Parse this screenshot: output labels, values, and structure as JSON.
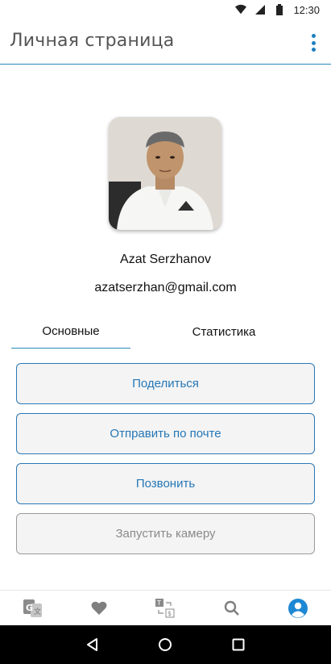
{
  "status_bar": {
    "time": "12:30",
    "icons": [
      "wifi-icon",
      "signal-icon",
      "battery-icon"
    ]
  },
  "app_bar": {
    "title": "Личная страница",
    "menu_icon": "more-vert-icon"
  },
  "profile": {
    "name": "Azat Serzhanov",
    "email": "azatserzhan@gmail.com"
  },
  "tabs": [
    {
      "label": "Основные",
      "active": true
    },
    {
      "label": "Статистика",
      "active": false
    }
  ],
  "actions": [
    {
      "label": "Поделиться",
      "enabled": true
    },
    {
      "label": "Отправить по почте",
      "enabled": true
    },
    {
      "label": "Позвонить",
      "enabled": true
    },
    {
      "label": "Запустить камеру",
      "enabled": false
    }
  ],
  "bottom_nav": [
    {
      "icon": "translate-icon"
    },
    {
      "icon": "heart-icon"
    },
    {
      "icon": "quiz-icon"
    },
    {
      "icon": "search-icon"
    },
    {
      "icon": "profile-icon",
      "active": true
    }
  ],
  "colors": {
    "accent": "#2577b6",
    "accent_line": "#2a8ab8",
    "disabled": "#8a8a8a"
  }
}
